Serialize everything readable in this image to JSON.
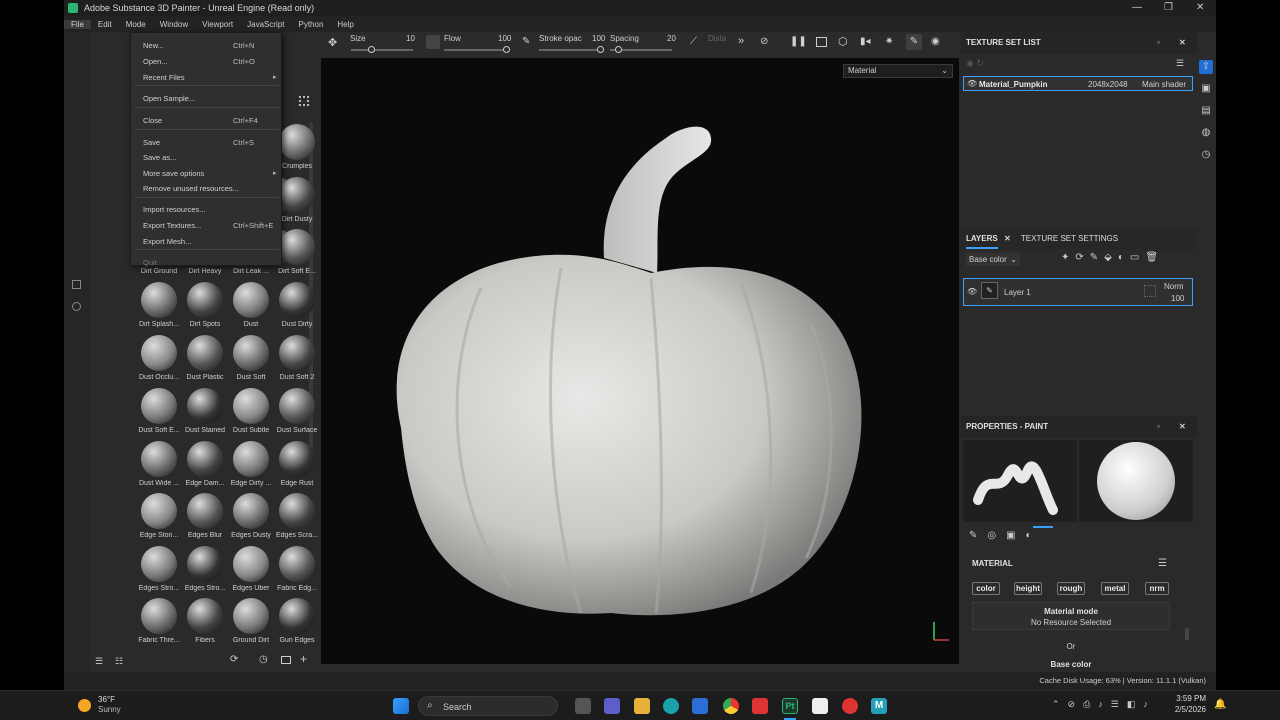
{
  "window": {
    "title": "Adobe Substance 3D Painter - Unreal Engine (Read only)"
  },
  "menubar": [
    "File",
    "Edit",
    "Mode",
    "Window",
    "Viewport",
    "JavaScript",
    "Python",
    "Help"
  ],
  "file_menu": [
    {
      "label": "New...",
      "shortcut": "Ctrl+N"
    },
    {
      "label": "Open...",
      "shortcut": "Ctrl+O"
    },
    {
      "label": "Recent Files",
      "shortcut": ""
    },
    {
      "label": "Open Sample...",
      "shortcut": ""
    },
    {
      "label": "Close",
      "shortcut": "Ctrl+F4"
    },
    {
      "label": "Save",
      "shortcut": "Ctrl+S"
    },
    {
      "label": "Save as...",
      "shortcut": ""
    },
    {
      "label": "More save options",
      "shortcut": ""
    },
    {
      "label": "Remove unused resources...",
      "shortcut": ""
    },
    {
      "label": "Import resources...",
      "shortcut": ""
    },
    {
      "label": "Export Textures...",
      "shortcut": "Ctrl+Shift+E"
    },
    {
      "label": "Export Mesh...",
      "shortcut": ""
    },
    {
      "label": "Quit",
      "shortcut": ""
    }
  ],
  "shelf_tab_partial": "TS",
  "toolbar": {
    "size_label": "Size",
    "size_value": "10",
    "flow_label": "Flow",
    "flow_value": "100",
    "stroke_label": "Stroke opac",
    "stroke_value": "100",
    "spacing_label": "Spacing",
    "spacing_value": "20",
    "dist_label": "Dista"
  },
  "viewport": {
    "mode_select": "Material"
  },
  "shelf_items": [
    "",
    "Crumples",
    "Dirt Dusty",
    "Dirt Ground",
    "Dirt Heavy",
    "Dirt Leak ...",
    "Dirt Soft E...",
    "Dirt Splash...",
    "Dirt Spots",
    "Dust",
    "Dust Dirty",
    "Dust Occlu...",
    "Dust Plastic",
    "Dust Soft",
    "Dust Soft 2",
    "Dust Soft E...",
    "Dust Stained",
    "Dust Subtle",
    "Dust Surface",
    "Dust Wide ...",
    "Edge Dam...",
    "Edge Dirty ...",
    "Edge Rust",
    "Edge Ston...",
    "Edges Blur",
    "Edges Dusty",
    "Edges Scra...",
    "Edges Stro...",
    "Edges Stro...",
    "Edges Uber",
    "Fabric Edg...",
    "Fabric Thre...",
    "Fibers",
    "Ground Dirt",
    "Gun Edges"
  ],
  "texture_set_list": {
    "title": "TEXTURE SET LIST",
    "material": "Material_Pumpkin",
    "resolution": "2048x2048",
    "shader": "Main shader"
  },
  "layers": {
    "tab1": "LAYERS",
    "tab2": "TEXTURE SET SETTINGS",
    "channel": "Base color",
    "layer_name": "Layer 1",
    "blend": "Norm",
    "opacity": "100"
  },
  "properties": {
    "title": "PROPERTIES - PAINT",
    "material_title": "MATERIAL",
    "channels": [
      "color",
      "height",
      "rough",
      "metal",
      "nrm"
    ],
    "material_mode": "Material mode",
    "no_resource": "No Resource Selected",
    "or": "Or",
    "base_color": "Base color"
  },
  "status": {
    "text": "Cache Disk Usage:  63% | Version: 11.1.1 (Vulkan)"
  },
  "taskbar": {
    "temp": "36°F",
    "weather": "Sunny",
    "search": "Search",
    "time": "3:59 PM",
    "date": "2/5/2026"
  },
  "colors": {
    "accent": "#3aa0ff",
    "panel": "#2a2a2a",
    "viewport": "#0a0a0a"
  }
}
